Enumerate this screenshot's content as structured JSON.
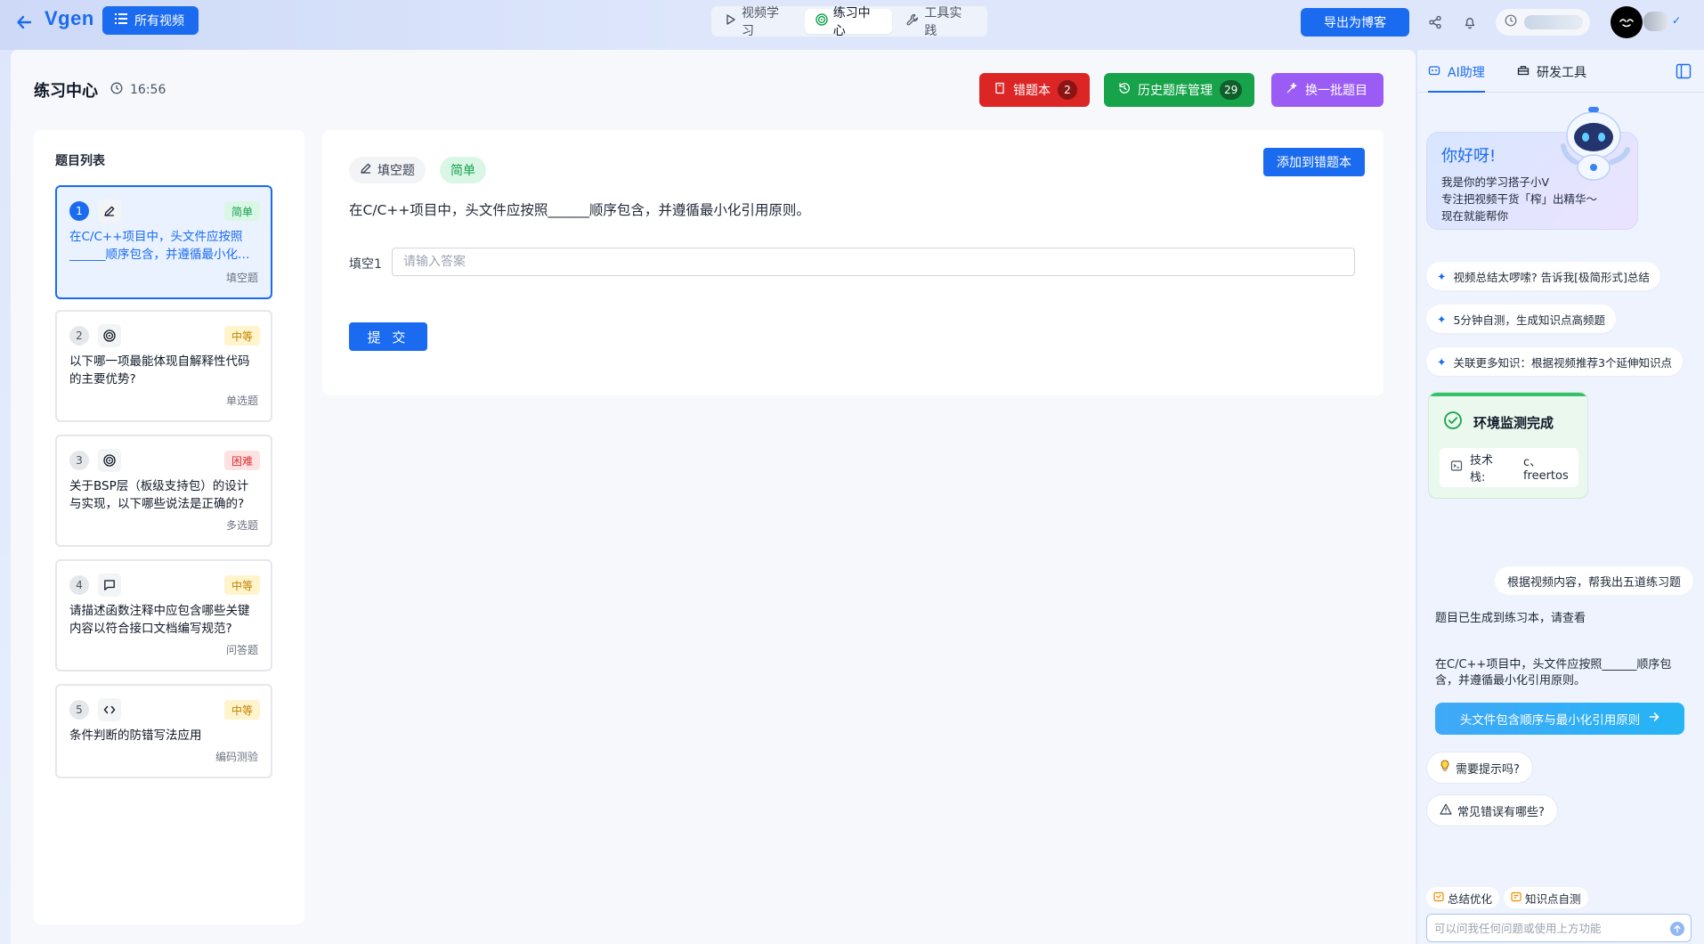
{
  "topbar": {
    "logo": "Vgen",
    "all_videos": "所有视频",
    "tabs": [
      {
        "label": "视频学习"
      },
      {
        "label": "练习中心"
      },
      {
        "label": "工具实践"
      }
    ],
    "export_label": "导出为博客"
  },
  "practice": {
    "title": "练习中心",
    "timer": "16:56",
    "wrong_book": {
      "label": "错题本",
      "count": "2",
      "color": "#dc2626"
    },
    "history": {
      "label": "历史题库管理",
      "count": "29",
      "color": "#16a34a"
    },
    "refresh": {
      "label": "换一批题目",
      "color": "#8b5cf6"
    }
  },
  "question_list": {
    "title": "题目列表",
    "items": [
      {
        "num": "1",
        "icon": "pencil-icon",
        "difficulty": "简单",
        "text": "在C/C++项目中，头文件应按照______顺序包含，并遵循最小化引用原则。",
        "type": "填空题"
      },
      {
        "num": "2",
        "icon": "target-icon",
        "difficulty": "中等",
        "text": "以下哪一项最能体现自解释性代码的主要优势?",
        "type": "单选题"
      },
      {
        "num": "3",
        "icon": "target-icon",
        "difficulty": "困难",
        "text": "关于BSP层（板级支持包）的设计与实现，以下哪些说法是正确的?",
        "type": "多选题"
      },
      {
        "num": "4",
        "icon": "chat-icon",
        "difficulty": "中等",
        "text": "请描述函数注释中应包含哪些关键内容以符合接口文档编写规范?",
        "type": "问答题"
      },
      {
        "num": "5",
        "icon": "code-icon",
        "difficulty": "中等",
        "text": "条件判断的防错写法应用",
        "type": "编码测验"
      }
    ]
  },
  "detail": {
    "type_tag": "填空题",
    "difficulty_tag": "简单",
    "add_wrong": "添加到错题本",
    "question": "在C/C++项目中，头文件应按照______顺序包含，并遵循最小化引用原则。",
    "blank_label": "填空1",
    "blank_placeholder": "请输入答案",
    "submit": "提 交"
  },
  "assistant": {
    "tabs": [
      {
        "label": "AI助理"
      },
      {
        "label": "研发工具"
      }
    ],
    "greeting_title": "你好呀!",
    "greeting_lines": [
      "我是你的学习搭子小V",
      "专注把视频干货「榨」出精华～",
      "现在就能帮你"
    ],
    "chips": [
      "视频总结太啰嗦? 告诉我[极简形式]总结",
      "5分钟自测，生成知识点高频题",
      "关联更多知识：根据视频推荐3个延伸知识点"
    ],
    "env_title": "环境监测完成",
    "env_stack_label": "技术栈:",
    "env_stack_value": "c、freertos",
    "user_message": "根据视频内容，帮我出五道练习题",
    "bot_reply_1": "题目已生成到练习本，请查看",
    "bot_reply_2": "在C/C++项目中，头文件应按照______顺序包含，并遵循最小化引用原则。",
    "link_button": "头文件包含顺序与最小化引用原则",
    "hint_1": "需要提示吗?",
    "hint_2": "常见错误有哪些?",
    "tool_1": "总结优化",
    "tool_2": "知识点自测",
    "ask_placeholder": "可以问我任何问题或使用上方功能"
  }
}
